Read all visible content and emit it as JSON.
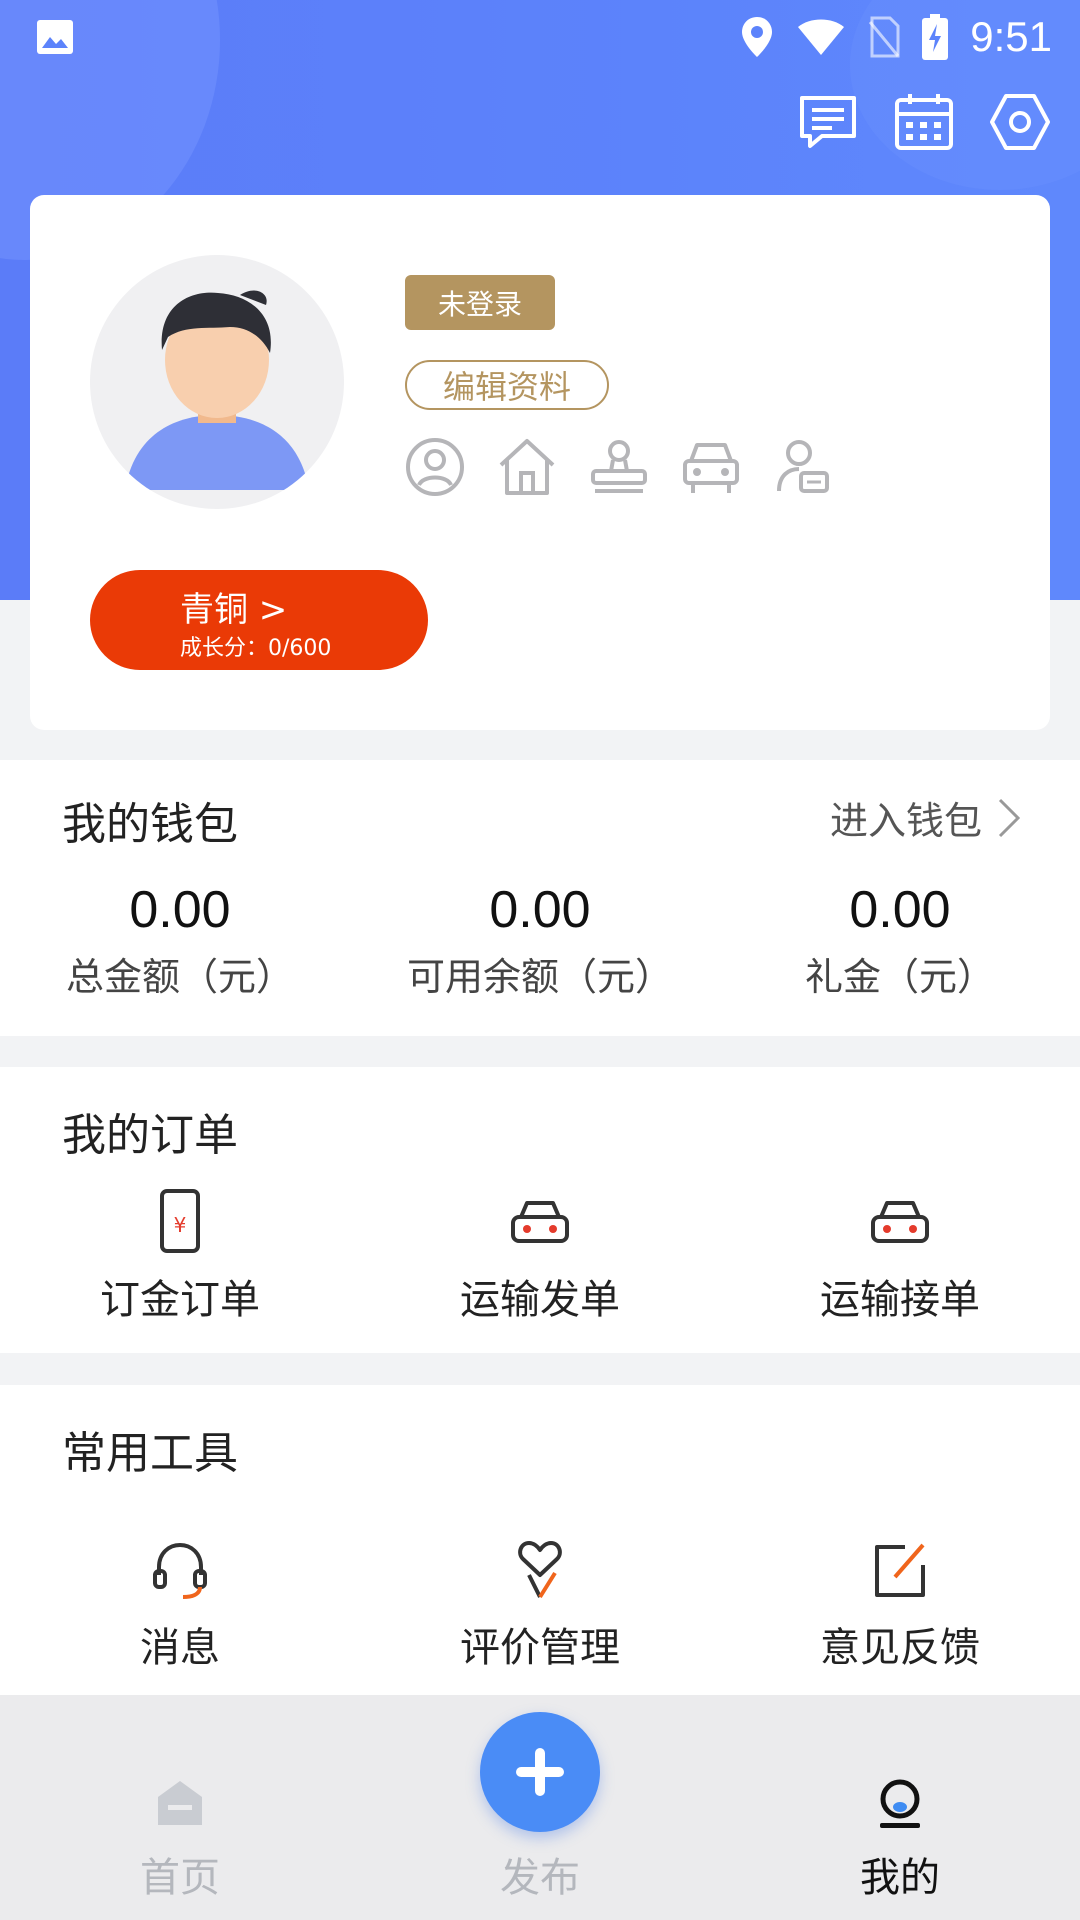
{
  "status_bar": {
    "time": "9:51"
  },
  "profile": {
    "login_status": "未登录",
    "edit_label": "编辑资料",
    "level_name": "青铜 >",
    "growth_score": "成长分：0/600"
  },
  "wallet": {
    "title": "我的钱包",
    "enter_label": "进入钱包",
    "stats": [
      {
        "value": "0.00",
        "label": "总金额（元）"
      },
      {
        "value": "0.00",
        "label": "可用余额（元）"
      },
      {
        "value": "0.00",
        "label": "礼金（元）"
      }
    ]
  },
  "orders": {
    "title": "我的订单",
    "items": [
      {
        "label": "订金订单",
        "icon": "deposit-phone-icon"
      },
      {
        "label": "运输发单",
        "icon": "car-icon"
      },
      {
        "label": "运输接单",
        "icon": "car-icon"
      }
    ]
  },
  "tools": {
    "title": "常用工具",
    "items": [
      {
        "label": "消息",
        "icon": "headset-icon"
      },
      {
        "label": "评价管理",
        "icon": "heart-hand-icon"
      },
      {
        "label": "意见反馈",
        "icon": "edit-icon"
      }
    ]
  },
  "nav": {
    "items": [
      {
        "label": "首页",
        "icon": "home-icon"
      },
      {
        "label": "发布",
        "icon": "plus-icon"
      },
      {
        "label": "我的",
        "icon": "profile-icon",
        "active": true
      }
    ]
  },
  "colors": {
    "primary_blue": "#5c83fb",
    "gold": "#b49560",
    "level_red": "#ea3a06",
    "fab_blue": "#4a8cf6"
  }
}
